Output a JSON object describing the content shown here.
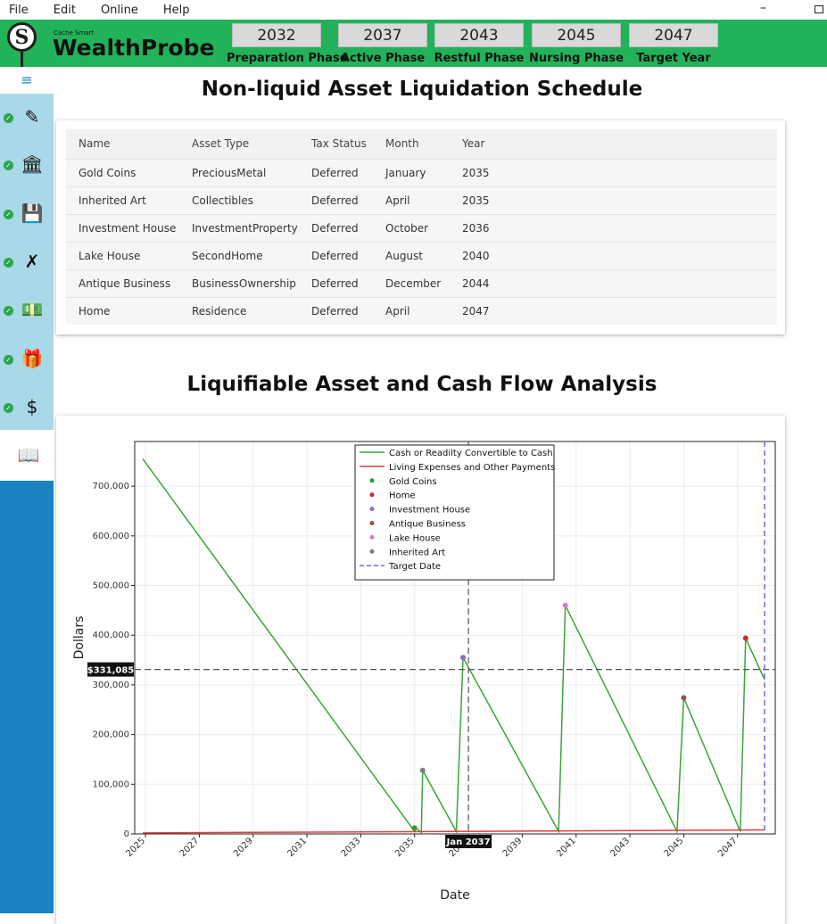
{
  "menu": [
    "File",
    "Edit",
    "Online",
    "Help"
  ],
  "window": {
    "minimize_glyph": "–",
    "maximize_icon": "maximize-icon"
  },
  "header": {
    "brand_small": "Cache Smart",
    "brand_name": "WealthProbe",
    "logo_letter": "S",
    "phases": [
      {
        "year": "2032",
        "label": "Preparation Phase"
      },
      {
        "year": "2037",
        "label": "Active Phase"
      },
      {
        "year": "2043",
        "label": "Restful Phase"
      },
      {
        "year": "2045",
        "label": "Nursing Phase"
      },
      {
        "year": "2047",
        "label": "Target Year"
      }
    ],
    "color": "#22b35a"
  },
  "sidebar": {
    "menu_glyph": "≡",
    "items": [
      {
        "icon": "person-edit-icon",
        "glyph": "✎",
        "checked": true
      },
      {
        "icon": "bank-icon",
        "glyph": "🏛",
        "checked": true
      },
      {
        "icon": "save-alert-icon",
        "glyph": "💾",
        "checked": true
      },
      {
        "icon": "route-cancel-icon",
        "glyph": "✗",
        "checked": true
      },
      {
        "icon": "banknote-icon",
        "glyph": "💵",
        "checked": true
      },
      {
        "icon": "gift-icon",
        "glyph": "🎁",
        "checked": true
      },
      {
        "icon": "no-money-icon",
        "glyph": "$",
        "checked": true
      }
    ],
    "active_item": {
      "icon": "book-open-icon",
      "glyph": "📖"
    }
  },
  "liquidation": {
    "title": "Non-liquid Asset Liquidation Schedule",
    "columns": [
      "Name",
      "Asset Type",
      "Tax Status",
      "Month",
      "Year"
    ],
    "rows": [
      [
        "Gold Coins",
        "PreciousMetal",
        "Deferred",
        "January",
        "2035"
      ],
      [
        "Inherited Art",
        "Collectibles",
        "Deferred",
        "April",
        "2035"
      ],
      [
        "Investment House",
        "InvestmentProperty",
        "Deferred",
        "October",
        "2036"
      ],
      [
        "Lake House",
        "SecondHome",
        "Deferred",
        "August",
        "2040"
      ],
      [
        "Antique Business",
        "BusinessOwnership",
        "Deferred",
        "December",
        "2044"
      ],
      [
        "Home",
        "Residence",
        "Deferred",
        "April",
        "2047"
      ]
    ]
  },
  "analysis": {
    "title": "Liquifiable Asset and Cash Flow Analysis"
  },
  "chart_data": {
    "type": "line",
    "xlabel": "Date",
    "ylabel": "Dollars",
    "xlim": [
      2024.6,
      2048.4
    ],
    "ylim": [
      0,
      790000
    ],
    "x_ticks": [
      "2025",
      "2027",
      "2029",
      "2031",
      "2033",
      "2035",
      "2037",
      "2039",
      "2041",
      "2043",
      "2045",
      "2047"
    ],
    "y_ticks": [
      0,
      100000,
      200000,
      300000,
      400000,
      500000,
      600000,
      700000
    ],
    "y_tick_labels": [
      "0",
      "100,000",
      "200,000",
      "300,000",
      "400,000",
      "500,000",
      "600,000",
      "700,000"
    ],
    "grid": true,
    "legend_position": "top-center",
    "crosshair": {
      "x_label": "Jan 2037",
      "y_label": "$331,085",
      "x": 2037.0,
      "y": 331085
    },
    "series": [
      {
        "name": "Cash or Readilty Convertible to Cash",
        "color": "#3aa53a",
        "x": [
          2024.9,
          2035.0,
          2035.05,
          2035.25,
          2035.3,
          2036.55,
          2036.8,
          2040.35,
          2040.6,
          2044.75,
          2045.0,
          2047.1,
          2047.3,
          2048.0
        ],
        "y": [
          755000,
          5000,
          12000,
          3000,
          128000,
          5000,
          355000,
          5000,
          460000,
          5000,
          274000,
          5000,
          394000,
          311000
        ]
      },
      {
        "name": "Living Expenses and Other Payments",
        "color": "#e03c3c",
        "x": [
          2024.9,
          2048.0
        ],
        "y": [
          2000,
          8000
        ]
      }
    ],
    "events": [
      {
        "name": "Gold Coins",
        "color": "#2ca02c",
        "x": 2035.0,
        "y": 12000
      },
      {
        "name": "Home",
        "color": "#d62728",
        "x": 2047.3,
        "y": 394000
      },
      {
        "name": "Investment House",
        "color": "#9467bd",
        "x": 2036.8,
        "y": 355000
      },
      {
        "name": "Antique Business",
        "color": "#8c564b",
        "x": 2045.0,
        "y": 274000
      },
      {
        "name": "Lake House",
        "color": "#e377c2",
        "x": 2040.6,
        "y": 460000
      },
      {
        "name": "Inherited Art",
        "color": "#7f7f7f",
        "x": 2035.3,
        "y": 128000
      }
    ],
    "target_line": {
      "name": "Target Date",
      "color": "#6b6bff",
      "x": 2048.0
    }
  }
}
